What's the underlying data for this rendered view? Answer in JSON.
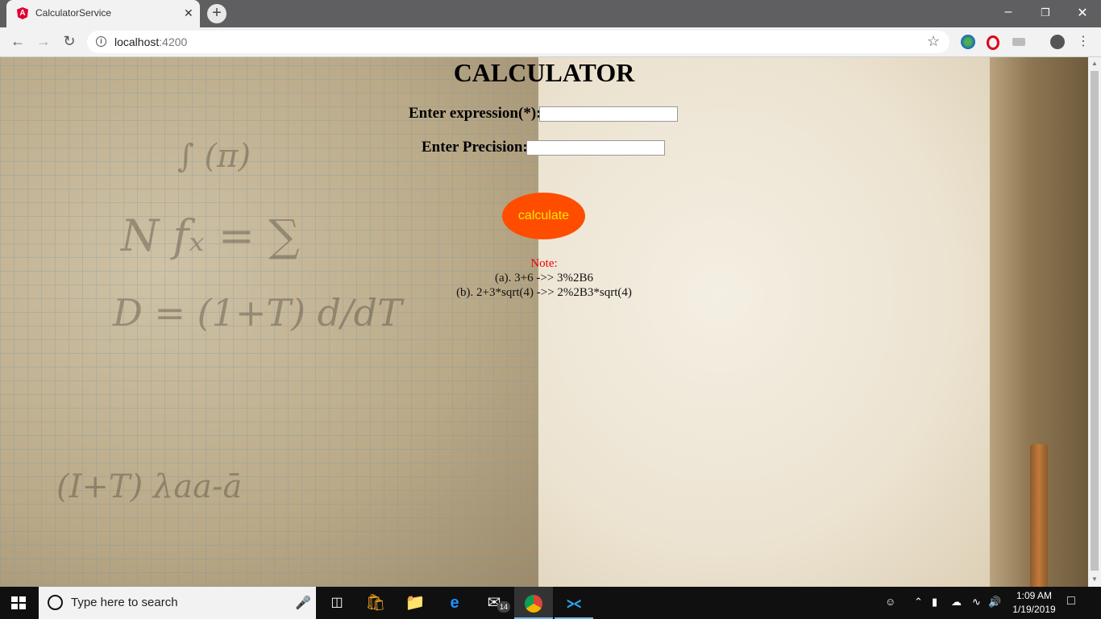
{
  "browser": {
    "tab_title": "CalculatorService",
    "tab_close": "✕",
    "new_tab": "+",
    "url_host": "localhost",
    "url_port": ":4200",
    "window_controls": [
      "–",
      "❐",
      "✕"
    ]
  },
  "page": {
    "heading": "CALCULATOR",
    "expression_label": "Enter expression(*):",
    "expression_value": "",
    "precision_label": "Enter Precision:",
    "precision_value": "",
    "calculate_label": "calculate",
    "note_label": "Note:",
    "note_lines": [
      "(a). 3+6 ->> 3%2B6",
      "(b). 2+3*sqrt(4) ->> 2%2B3*sqrt(4)"
    ]
  },
  "taskbar": {
    "search_placeholder": "Type here to search",
    "mail_badge": "14",
    "time": "1:09 AM",
    "date": "1/19/2019"
  },
  "colors": {
    "button_bg": "#ff4d00",
    "button_text": "#ffe600",
    "note_label": "#ee0000",
    "angular_red": "#dd0031"
  }
}
